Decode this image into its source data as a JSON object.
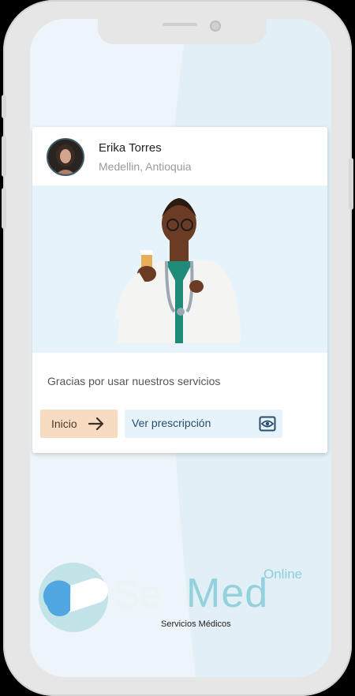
{
  "profile": {
    "name": "Erika Torres",
    "location": "Medellin, Antioquia"
  },
  "card": {
    "message": "Gracias por usar nuestros servicios"
  },
  "actions": {
    "home_label": "Inicio",
    "prescription_label": "Ver prescripción"
  },
  "brand": {
    "online": "Online",
    "name_part1": "Se",
    "name_part2": "Med",
    "subtitle": "Servicios Médicos"
  },
  "icons": {
    "home_arrow": "arrow-right-icon",
    "view": "eye-icon"
  },
  "colors": {
    "accent_peach": "#f8dcc1",
    "accent_light_blue": "#e7f3fa",
    "brand_teal": "#93d2dc"
  }
}
